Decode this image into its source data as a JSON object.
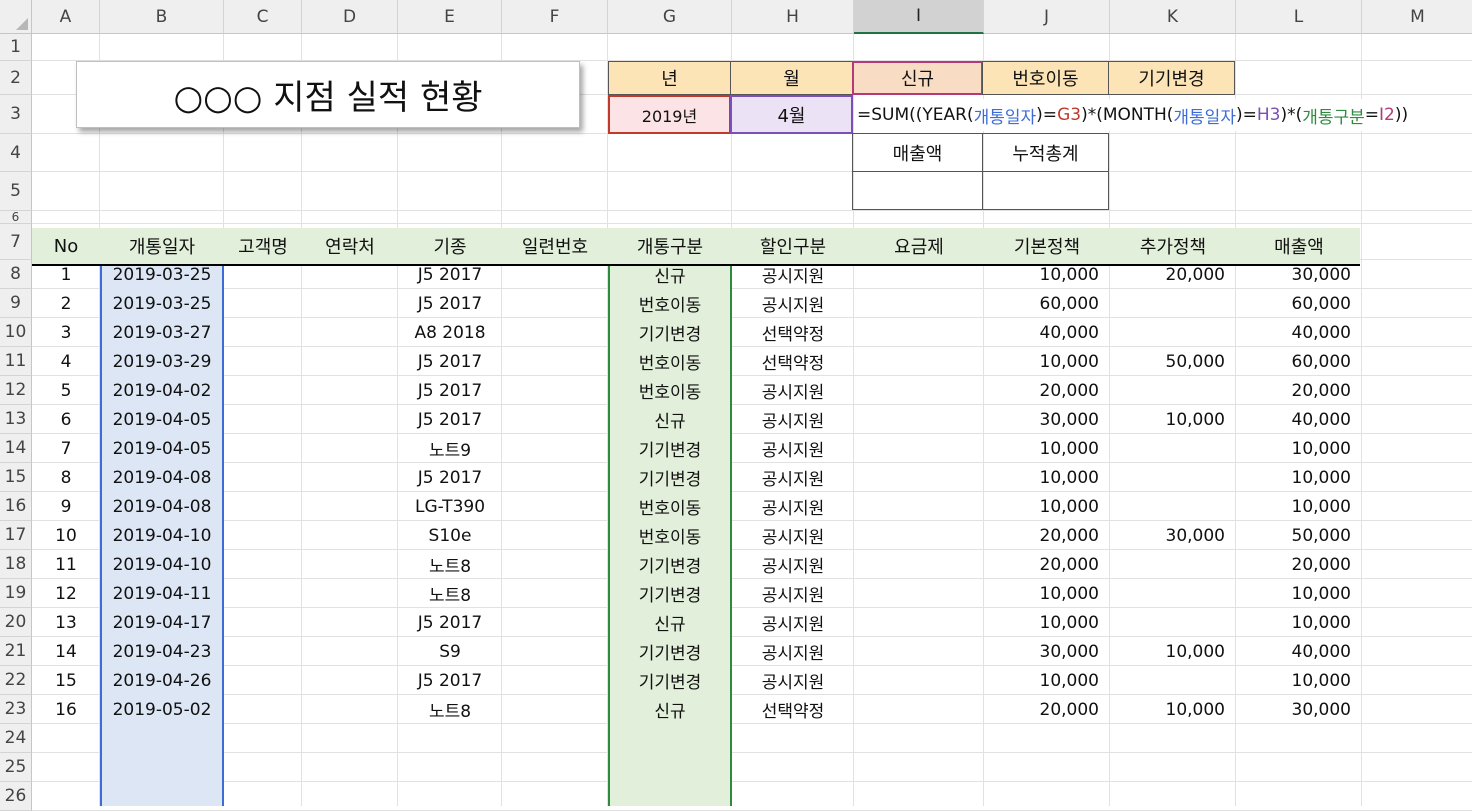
{
  "columns": [
    "A",
    "B",
    "C",
    "D",
    "E",
    "F",
    "G",
    "H",
    "I",
    "J",
    "K",
    "L",
    "M"
  ],
  "rows": [
    "1",
    "2",
    "3",
    "4",
    "5",
    "6",
    "7",
    "8",
    "9",
    "10",
    "11",
    "12",
    "13",
    "14",
    "15",
    "16",
    "17",
    "18",
    "19",
    "20",
    "21",
    "22",
    "23",
    "24",
    "25",
    "26"
  ],
  "title": "○○○ 지점  실적 현황",
  "summary": {
    "year_label": "년",
    "month_label": "월",
    "new_label": "신규",
    "port_label": "번호이동",
    "change_label": "기기변경",
    "year_value": "2019년",
    "month_value": "4월",
    "sales_label": "매출액",
    "cumulative_label": "누적총계"
  },
  "formula": [
    {
      "text": "=SUM((YEAR(",
      "color": "#111111"
    },
    {
      "text": "개통일자",
      "color": "#3d6cd6"
    },
    {
      "text": ")=",
      "color": "#111111"
    },
    {
      "text": "G3",
      "color": "#c0392b"
    },
    {
      "text": ")*(MONTH(",
      "color": "#111111"
    },
    {
      "text": "개통일자",
      "color": "#3d6cd6"
    },
    {
      "text": ")=",
      "color": "#111111"
    },
    {
      "text": "H3",
      "color": "#7b4fb5"
    },
    {
      "text": ")*(",
      "color": "#111111"
    },
    {
      "text": "개통구분",
      "color": "#2e8b3e"
    },
    {
      "text": "=",
      "color": "#111111"
    },
    {
      "text": "I2",
      "color": "#b5397a"
    },
    {
      "text": "))",
      "color": "#111111"
    }
  ],
  "table": {
    "headers": [
      "No",
      "개통일자",
      "고객명",
      "연락처",
      "기종",
      "일련번호",
      "개통구분",
      "할인구분",
      "요금제",
      "기본정책",
      "추가정책",
      "매출액"
    ],
    "rows": [
      [
        "1",
        "2019-03-25",
        "",
        "",
        "J5 2017",
        "",
        "신규",
        "공시지원",
        "",
        "10,000",
        "20,000",
        "30,000"
      ],
      [
        "2",
        "2019-03-25",
        "",
        "",
        "J5 2017",
        "",
        "번호이동",
        "공시지원",
        "",
        "60,000",
        "",
        "60,000"
      ],
      [
        "3",
        "2019-03-27",
        "",
        "",
        "A8 2018",
        "",
        "기기변경",
        "선택약정",
        "",
        "40,000",
        "",
        "40,000"
      ],
      [
        "4",
        "2019-03-29",
        "",
        "",
        "J5 2017",
        "",
        "번호이동",
        "선택약정",
        "",
        "10,000",
        "50,000",
        "60,000"
      ],
      [
        "5",
        "2019-04-02",
        "",
        "",
        "J5 2017",
        "",
        "번호이동",
        "공시지원",
        "",
        "20,000",
        "",
        "20,000"
      ],
      [
        "6",
        "2019-04-05",
        "",
        "",
        "J5 2017",
        "",
        "신규",
        "공시지원",
        "",
        "30,000",
        "10,000",
        "40,000"
      ],
      [
        "7",
        "2019-04-05",
        "",
        "",
        "노트9",
        "",
        "기기변경",
        "공시지원",
        "",
        "10,000",
        "",
        "10,000"
      ],
      [
        "8",
        "2019-04-08",
        "",
        "",
        "J5 2017",
        "",
        "기기변경",
        "공시지원",
        "",
        "10,000",
        "",
        "10,000"
      ],
      [
        "9",
        "2019-04-08",
        "",
        "",
        "LG-T390",
        "",
        "번호이동",
        "공시지원",
        "",
        "10,000",
        "",
        "10,000"
      ],
      [
        "10",
        "2019-04-10",
        "",
        "",
        "S10e",
        "",
        "번호이동",
        "공시지원",
        "",
        "20,000",
        "30,000",
        "50,000"
      ],
      [
        "11",
        "2019-04-10",
        "",
        "",
        "노트8",
        "",
        "기기변경",
        "공시지원",
        "",
        "20,000",
        "",
        "20,000"
      ],
      [
        "12",
        "2019-04-11",
        "",
        "",
        "노트8",
        "",
        "기기변경",
        "공시지원",
        "",
        "10,000",
        "",
        "10,000"
      ],
      [
        "13",
        "2019-04-17",
        "",
        "",
        "J5 2017",
        "",
        "신규",
        "공시지원",
        "",
        "10,000",
        "",
        "10,000"
      ],
      [
        "14",
        "2019-04-23",
        "",
        "",
        "S9",
        "",
        "기기변경",
        "공시지원",
        "",
        "30,000",
        "10,000",
        "40,000"
      ],
      [
        "15",
        "2019-04-26",
        "",
        "",
        "J5 2017",
        "",
        "기기변경",
        "공시지원",
        "",
        "10,000",
        "",
        "10,000"
      ],
      [
        "16",
        "2019-05-02",
        "",
        "",
        "노트8",
        "",
        "신규",
        "선택약정",
        "",
        "20,000",
        "10,000",
        "30,000"
      ]
    ]
  },
  "colors": {
    "header_fill": "#e2efda",
    "summary_header_fill": "#fce4b6",
    "summary_active_fill": "#f8dcc4",
    "year_value_fill": "#fbe3e6",
    "month_value_fill": "#ebe3f5",
    "date_range_fill": "#dce6f5",
    "type_range_fill": "#e2efda"
  }
}
